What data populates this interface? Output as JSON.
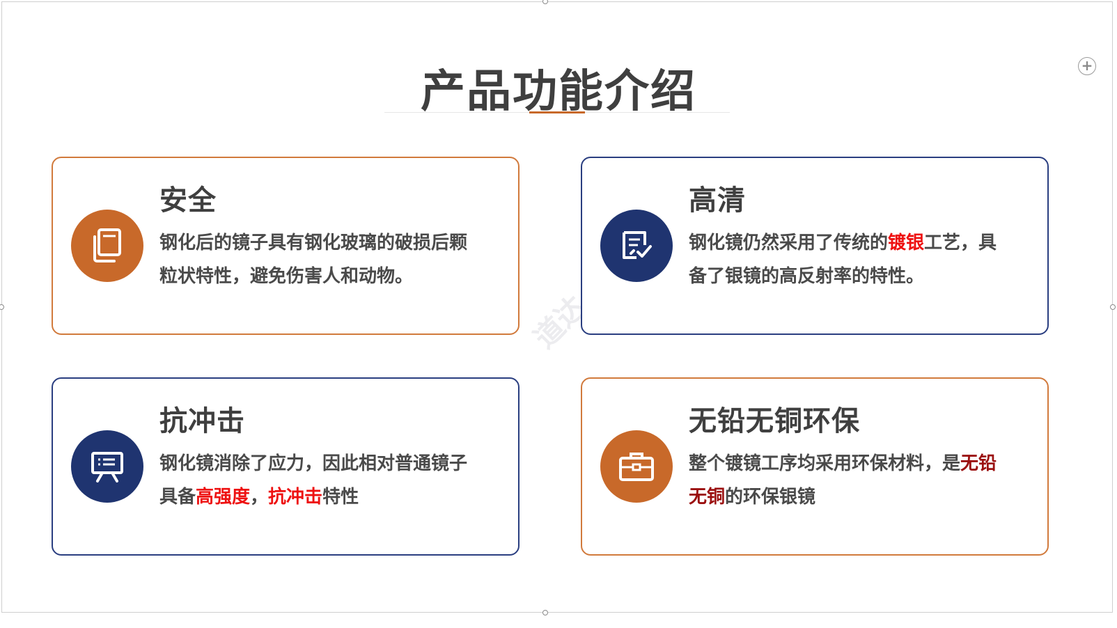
{
  "slide": {
    "title": "产品功能介绍",
    "add_icon": "plus-circle-icon",
    "watermark": "道达"
  },
  "colors": {
    "orange": "#c8692a",
    "navy": "#1f3470",
    "highlight": "#ee1111",
    "highlight_dark": "#9b1010"
  },
  "cards": [
    {
      "title": "安全",
      "icon": "book-icon",
      "theme": "orange",
      "desc": [
        {
          "text": "钢化后的镜子具有钢化玻璃的破损后颗粒状特性，避免伤害人和动物。",
          "hl": false
        }
      ]
    },
    {
      "title": "高清",
      "icon": "checklist-icon",
      "theme": "navy",
      "desc": [
        {
          "text": "钢化镜仍然采用了传统的",
          "hl": false
        },
        {
          "text": "镀银",
          "hl": true
        },
        {
          "text": "工艺，具备了银镜的高反射率的特性。",
          "hl": false
        }
      ]
    },
    {
      "title": "抗冲击",
      "icon": "presentation-board-icon",
      "theme": "navy",
      "desc": [
        {
          "text": "钢化镜消除了应力，因此相对普通镜子具备",
          "hl": false
        },
        {
          "text": "高强度",
          "hl": true
        },
        {
          "text": "，",
          "hl": false
        },
        {
          "text": "抗冲击",
          "hl": true
        },
        {
          "text": "特性",
          "hl": false
        }
      ]
    },
    {
      "title": "无铅无铜环保",
      "icon": "briefcase-icon",
      "theme": "orange",
      "desc": [
        {
          "text": "整个镀镜工序均采用环保材料，是",
          "hl": false
        },
        {
          "text": "无铅无铜",
          "hl": "dark"
        },
        {
          "text": "的环保银镜",
          "hl": false
        }
      ]
    }
  ]
}
